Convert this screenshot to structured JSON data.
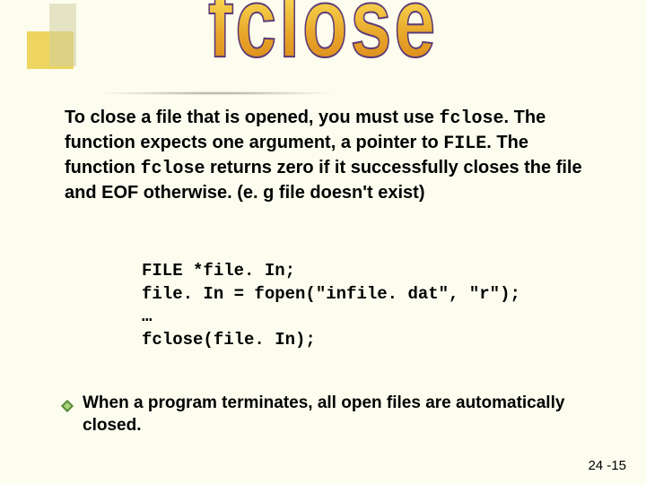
{
  "title": "fclose",
  "para1": {
    "t1": "To close a file that is opened, you must use ",
    "c1": "fclose",
    "t2": ". The function expects one argument, a pointer to ",
    "c2": "FILE",
    "t3": ". The function ",
    "c3": "fclose",
    "t4": " returns zero if it successfully closes the file and EOF otherwise. (e. g file doesn't exist)"
  },
  "code": {
    "l1": "FILE *file. In;",
    "l2": "",
    "l3": "file. In = fopen(\"infile. dat\", \"r\");",
    "l4": "…",
    "l5": "fclose(file. In);"
  },
  "para2": "When a program terminates, all open files are automatically closed.",
  "pagenum": "24 -15"
}
